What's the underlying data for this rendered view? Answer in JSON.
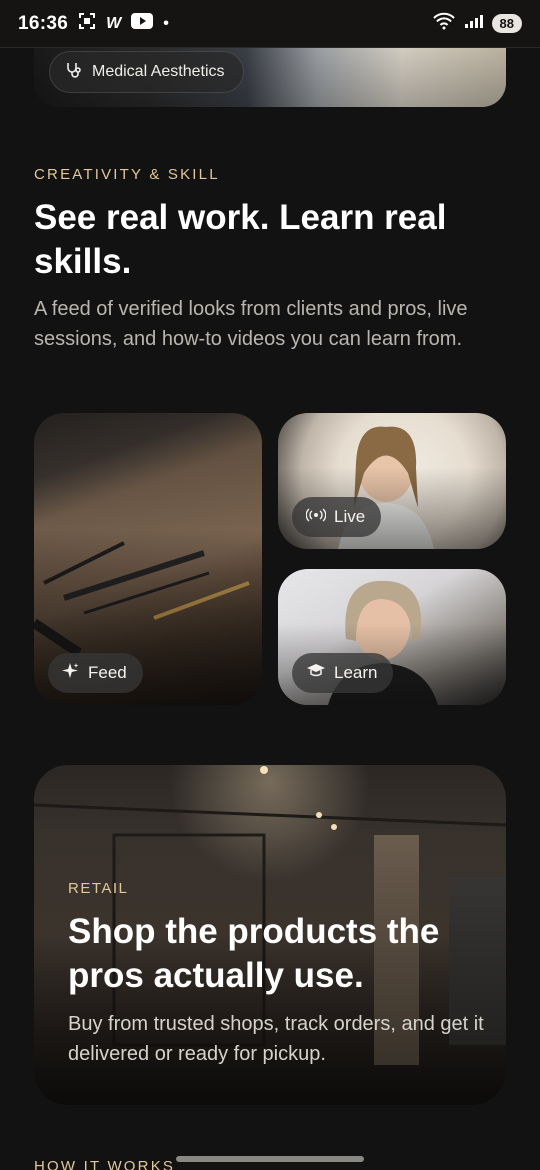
{
  "status_bar": {
    "time": "16:36",
    "app_icons": [
      "screenshot-icon",
      "w-icon",
      "youtube-icon",
      "dot-icon"
    ],
    "battery": "88"
  },
  "top_card": {
    "chip_label": "Medical Aesthetics",
    "chip_icon": "stethoscope-icon"
  },
  "creativity": {
    "eyebrow": "CREATIVITY & SKILL",
    "heading": "See real work. Learn real skills.",
    "description": "A feed of verified looks from clients and pros, live sessions, and how-to videos you can learn from.",
    "tiles": [
      {
        "label": "Feed",
        "icon": "sparkle-icon"
      },
      {
        "label": "Live",
        "icon": "broadcast-icon"
      },
      {
        "label": "Learn",
        "icon": "graduation-cap-icon"
      }
    ]
  },
  "retail": {
    "eyebrow": "RETAIL",
    "heading": "Shop the products the pros actually use.",
    "description": "Buy from trusted shops, track orders, and get it delivered or ready for pickup."
  },
  "next_section": {
    "eyebrow": "HOW IT WORKS"
  },
  "colors": {
    "background": "#121212",
    "accent": "#e2c89a",
    "chip_bg": "#373737"
  }
}
